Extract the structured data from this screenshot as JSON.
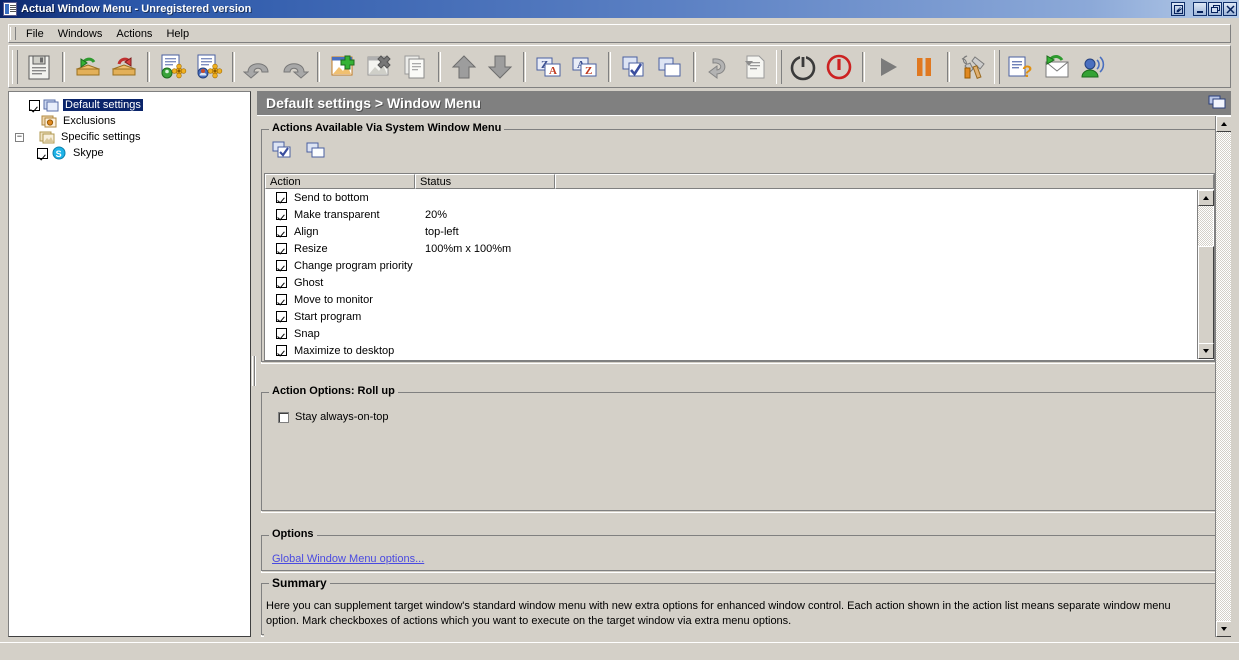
{
  "window": {
    "title": "Actual Window Menu - Unregistered version",
    "icon": "app-window-icon",
    "buttons": {
      "roll": "❐",
      "minimize": "_",
      "restore": "□",
      "close": "✕"
    }
  },
  "menubar": {
    "items": [
      {
        "label": "File"
      },
      {
        "label": "Windows"
      },
      {
        "label": "Actions"
      },
      {
        "label": "Help"
      }
    ]
  },
  "toolbar": {
    "groups": [
      {
        "buttons": [
          {
            "name": "save-icon",
            "enabled": true
          }
        ]
      },
      {
        "buttons": [
          {
            "name": "import-settings-icon",
            "enabled": true
          },
          {
            "name": "export-settings-icon",
            "enabled": true
          }
        ]
      },
      {
        "buttons": [
          {
            "name": "default-settings-icon",
            "enabled": true
          },
          {
            "name": "specific-settings-icon",
            "enabled": true
          }
        ]
      },
      {
        "buttons": [
          {
            "name": "undo-icon",
            "enabled": false
          },
          {
            "name": "redo-icon",
            "enabled": false
          }
        ]
      },
      {
        "buttons": [
          {
            "name": "add-window-icon",
            "enabled": true
          },
          {
            "name": "delete-window-icon",
            "enabled": true
          },
          {
            "name": "duplicate-window-icon",
            "enabled": false
          }
        ]
      },
      {
        "buttons": [
          {
            "name": "move-up-icon",
            "enabled": true
          },
          {
            "name": "move-down-icon",
            "enabled": true
          }
        ]
      },
      {
        "buttons": [
          {
            "name": "sort-descending-icon",
            "enabled": true
          },
          {
            "name": "sort-ascending-icon",
            "enabled": true
          }
        ]
      },
      {
        "buttons": [
          {
            "name": "check-all-icon",
            "enabled": true
          },
          {
            "name": "copy-settings-icon",
            "enabled": true
          }
        ]
      },
      {
        "buttons": [
          {
            "name": "reset-icon",
            "enabled": false
          },
          {
            "name": "apply-template-icon",
            "enabled": false
          }
        ]
      },
      {
        "buttons": [
          {
            "name": "power-icon",
            "enabled": true
          },
          {
            "name": "stop-icon",
            "enabled": true
          }
        ]
      },
      {
        "buttons": [
          {
            "name": "play-icon",
            "enabled": true
          },
          {
            "name": "pause-icon",
            "enabled": true
          }
        ]
      },
      {
        "buttons": [
          {
            "name": "configure-tools-icon",
            "enabled": true
          }
        ]
      },
      {
        "buttons": [
          {
            "name": "help-icon",
            "enabled": true
          },
          {
            "name": "mail-support-icon",
            "enabled": true
          },
          {
            "name": "about-icon",
            "enabled": true
          }
        ]
      }
    ]
  },
  "tree": {
    "nodes": [
      {
        "label": "Default settings",
        "icon": "default-settings-icon",
        "checkbox": "checked",
        "expander": "none",
        "selected": true,
        "indent": 0
      },
      {
        "label": "Exclusions",
        "icon": "exclusions-icon",
        "checkbox": "none",
        "expander": "none",
        "selected": false,
        "indent": 0
      },
      {
        "label": "Specific settings",
        "icon": "specific-settings-icon",
        "checkbox": "none",
        "expander": "collapse",
        "selected": false,
        "indent": 0
      },
      {
        "label": "Skype",
        "icon": "skype-icon",
        "checkbox": "checked",
        "expander": "none",
        "selected": false,
        "indent": 1
      }
    ],
    "expander_symbol": "−"
  },
  "page": {
    "header_title": "Default settings > Window Menu",
    "header_icon": "window-cascade-icon"
  },
  "actions_group": {
    "title": "Actions Available Via System Window Menu",
    "minibar": [
      {
        "name": "check-all-actions-icon"
      },
      {
        "name": "copy-actions-icon"
      }
    ],
    "columns": [
      "Action",
      "Status",
      ""
    ],
    "rows": [
      {
        "checked": true,
        "action": "Send to bottom",
        "status": ""
      },
      {
        "checked": true,
        "action": "Make transparent",
        "status": "20%"
      },
      {
        "checked": true,
        "action": "Align",
        "status": "top-left"
      },
      {
        "checked": true,
        "action": "Resize",
        "status": "100%m x 100%m"
      },
      {
        "checked": true,
        "action": "Change program priority",
        "status": ""
      },
      {
        "checked": true,
        "action": "Ghost",
        "status": ""
      },
      {
        "checked": true,
        "action": "Move to monitor",
        "status": ""
      },
      {
        "checked": true,
        "action": "Start program",
        "status": ""
      },
      {
        "checked": true,
        "action": "Snap",
        "status": ""
      },
      {
        "checked": true,
        "action": "Maximize to desktop",
        "status": ""
      }
    ]
  },
  "action_options_group": {
    "title": "Action Options: Roll up",
    "checkbox_label": "Stay always-on-top",
    "checkbox_checked": false
  },
  "options_group": {
    "title": "Options",
    "link_label": "Global Window Menu options..."
  },
  "summary_group": {
    "title": "Summary",
    "text": "Here you can supplement target window's standard window menu with new extra options for enhanced window control. Each action shown in the action list means separate window menu option. Mark checkboxes of actions which you want to execute on the target window via extra menu options."
  },
  "colors": {
    "title_bar_start": "#0a246a",
    "title_bar_end": "#b6cbe8",
    "page_header": "#808080",
    "face": "#d4d0c8",
    "selection": "#0a246a",
    "link": "#4a4ae0"
  }
}
